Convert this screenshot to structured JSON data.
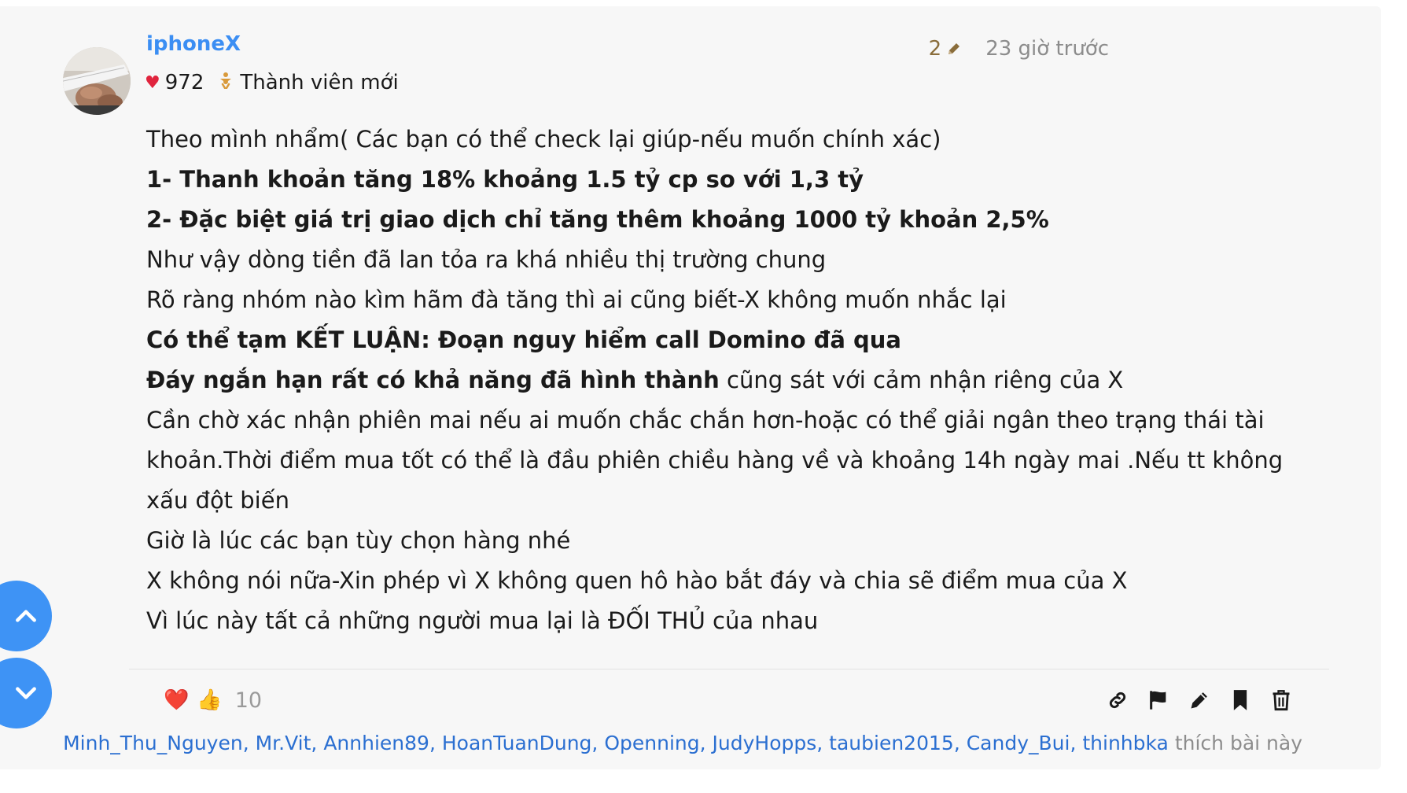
{
  "post": {
    "username": "iphoneX",
    "likes_count": "972",
    "rank": "Thành viên mới",
    "edit_count": "2",
    "time": "23 giờ trước",
    "lines": [
      {
        "parts": [
          {
            "t": "Theo mình nhẩm( Các bạn có thể check lại giúp-nếu muốn chính xác)",
            "b": false
          }
        ]
      },
      {
        "parts": [
          {
            "t": "1- Thanh khoản tăng 18% khoảng 1.5 tỷ cp so với 1,3 tỷ",
            "b": true
          }
        ]
      },
      {
        "parts": [
          {
            "t": "2- Đặc biệt giá trị giao dịch chỉ tăng thêm khoảng 1000 tỷ khoản 2,5%",
            "b": true
          }
        ]
      },
      {
        "parts": [
          {
            "t": "Như vậy dòng tiền đã lan tỏa ra khá nhiều thị trường chung",
            "b": false
          }
        ]
      },
      {
        "parts": [
          {
            "t": "Rõ ràng nhóm nào kìm hãm đà tăng thì ai cũng biết-X không muốn nhắc lại",
            "b": false
          }
        ]
      },
      {
        "parts": [
          {
            "t": "Có thể tạm KẾT LUẬN: Đoạn nguy hiểm call Domino đã qua",
            "b": true
          }
        ]
      },
      {
        "parts": [
          {
            "t": "Đáy ngắn hạn rất có khả năng đã hình thành",
            "b": true
          },
          {
            "t": " cũng sát với cảm nhận riêng của X",
            "b": false
          }
        ]
      },
      {
        "parts": [
          {
            "t": "Cần chờ xác nhận phiên mai nếu ai muốn chắc chắn hơn-hoặc có thể giải ngân theo trạng thái tài khoản.Thời điểm mua tốt có thể là đầu phiên chiều hàng về và khoảng 14h ngày mai .Nếu tt không xấu đột biến",
            "b": false
          }
        ]
      },
      {
        "parts": [
          {
            "t": "Giờ là lúc các bạn tùy chọn hàng nhé",
            "b": false
          }
        ]
      },
      {
        "parts": [
          {
            "t": "X không nói nữa-Xin phép vì X không quen hô hào bắt đáy và chia sẽ điểm mua của X",
            "b": false
          }
        ]
      },
      {
        "parts": [
          {
            "t": "Vì lúc này tất cả những người mua lại là ĐỐI THỦ của nhau",
            "b": false
          }
        ]
      }
    ],
    "reactions": {
      "emojis": [
        "❤️",
        "👍"
      ],
      "count": "10"
    },
    "actions": [
      "link-icon",
      "flag-icon",
      "pencil-icon",
      "bookmark-icon",
      "trash-icon"
    ],
    "likers": [
      "Minh_Thu_Nguyen",
      "Mr.Vit",
      "Annhien89",
      "HoanTuanDung",
      "Openning",
      "JudyHopps",
      "taubien2015",
      "Candy_Bui",
      "thinhbka"
    ],
    "likers_suffix": "thích bài này"
  },
  "colors": {
    "accent": "#3e93f5",
    "username": "#3b8ef3",
    "link": "#2b6fd1",
    "heart": "#e0243d",
    "edit": "#8a6d3b"
  }
}
